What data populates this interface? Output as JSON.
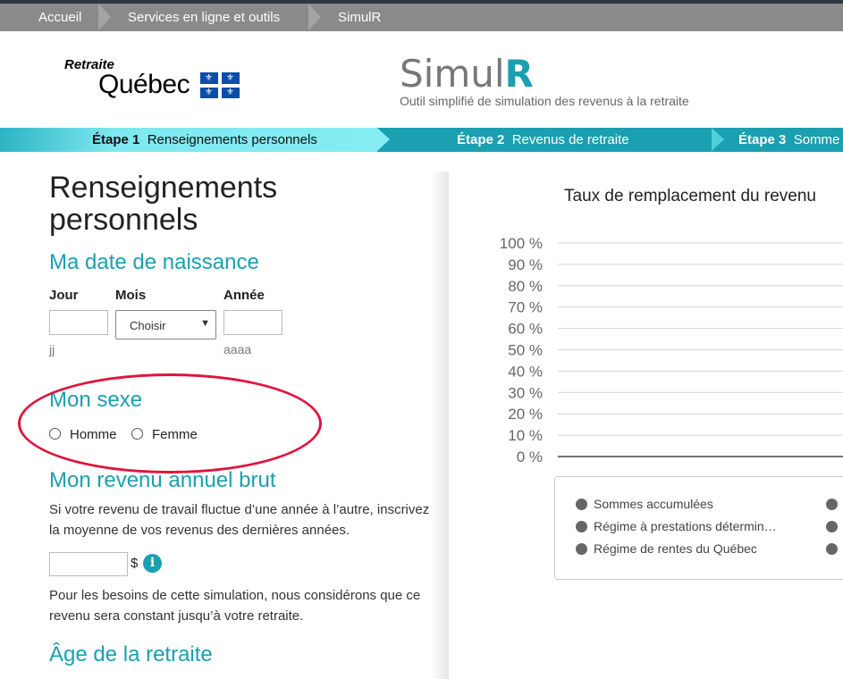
{
  "breadcrumb": [
    "Accueil",
    "Services en ligne et outils",
    "SimulR"
  ],
  "logo": {
    "small": "Retraite",
    "big": "Québec"
  },
  "app": {
    "title_a": "Simul",
    "title_b": "R",
    "subtitle": "Outil simplifié de simulation des revenus à la retraite"
  },
  "steps": [
    {
      "num": "Étape 1",
      "label": "Renseignements personnels",
      "active": true
    },
    {
      "num": "Étape 2",
      "label": "Revenus de retraite",
      "active": false
    },
    {
      "num": "Étape 3",
      "label": "Somme",
      "active": false
    }
  ],
  "form": {
    "title": "Renseignements personnels",
    "birth": {
      "heading": "Ma date de naissance",
      "day_label": "Jour",
      "month_label": "Mois",
      "year_label": "Année",
      "day_hint": "jj",
      "year_hint": "aaaa",
      "month_value": "Choisir"
    },
    "sex": {
      "heading": "Mon sexe",
      "options": [
        "Homme",
        "Femme"
      ]
    },
    "income": {
      "heading": "Mon revenu annuel brut",
      "intro": "Si votre revenu de travail fluctue d’une année à l’autre, inscrivez la moyenne de vos revenus des dernières années.",
      "currency": "$",
      "note": "Pour les besoins de cette simulation, nous considérons que ce revenu sera constant jusqu’à votre retraite."
    },
    "retirement": {
      "heading": "Âge de la retraite"
    }
  },
  "chart_data": {
    "type": "bar",
    "title": "Taux de remplacement du revenu",
    "y_ticks": [
      "100 %",
      "90 %",
      "80 %",
      "70 %",
      "60 %",
      "50 %",
      "40 %",
      "30 %",
      "20 %",
      "10 %",
      "0 %"
    ],
    "ylim": [
      0,
      100
    ],
    "series": [
      {
        "name": "Sommes accumulées",
        "values": []
      },
      {
        "name": "Régime à prestations détermin…",
        "values": []
      },
      {
        "name": "Régime de rentes du Québec",
        "values": []
      }
    ],
    "legend_placement": "bottom",
    "grid": true
  },
  "colors": {
    "accent": "#1aa0b0",
    "annotation": "#e0143c",
    "breadcrumb_bg": "#8a8a8a"
  }
}
